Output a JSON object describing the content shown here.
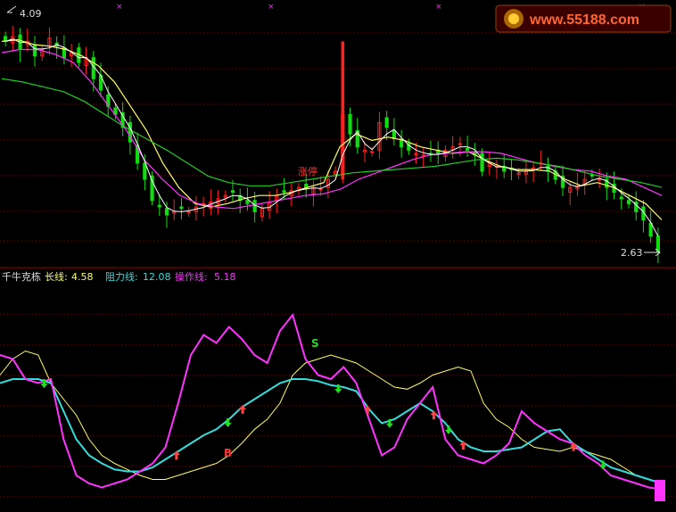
{
  "watermark": {
    "site": "www.55188.com"
  },
  "price_pane": {
    "high_label": "4.09",
    "low_label": "2.63",
    "limit_up_label": "涨停"
  },
  "indicator_pane": {
    "name": "千牛克栋",
    "lines": [
      {
        "key": "long",
        "label": "长线:",
        "value": "4.58",
        "color": "#ffff66"
      },
      {
        "key": "resistance",
        "label": "阻力线:",
        "value": "12.08",
        "color": "#33dddd"
      },
      {
        "key": "operation",
        "label": "操作线:",
        "value": "5.18",
        "color": "#ff33ff"
      }
    ],
    "signals": {
      "buy": "B",
      "sell": "S"
    }
  },
  "colors": {
    "up": "#ff2020",
    "down": "#11dd11",
    "ma5": "#ffffff",
    "ma10": "#ffff66",
    "ma20": "#ff33ff",
    "ma60": "#22cc22",
    "grid": "#7a0000",
    "divider": "#990000"
  },
  "chart_data": [
    {
      "type": "candlestick",
      "title": "",
      "ylim": [
        2.6,
        4.15
      ],
      "price_close_path": [
        3.95,
        3.98,
        3.9,
        3.95,
        3.86,
        3.9,
        3.97,
        3.92,
        3.85,
        3.88,
        3.82,
        3.85,
        3.72,
        3.65,
        3.55,
        3.5,
        3.42,
        3.33,
        3.2,
        3.1,
        2.97,
        2.93,
        2.88,
        2.9,
        2.92,
        2.9,
        2.93,
        2.95,
        2.96,
        2.98,
        3.0,
        3.02,
        2.97,
        2.95,
        2.9,
        2.92,
        2.96,
        3.0,
        3.02,
        3.03,
        3.05,
        3.04,
        3.05,
        3.04,
        3.1,
        3.15,
        3.5,
        3.38,
        3.3,
        3.28,
        3.27,
        3.45,
        3.42,
        3.35,
        3.3,
        3.28,
        3.26,
        3.25,
        3.25,
        3.26,
        3.28,
        3.3,
        3.32,
        3.28,
        3.25,
        3.15,
        3.2,
        3.18,
        3.15,
        3.16,
        3.14,
        3.15,
        3.17,
        3.2,
        3.15,
        3.1,
        3.05,
        3.05,
        3.06,
        3.1,
        3.12,
        3.1,
        3.05,
        3.02,
        2.98,
        2.95,
        2.9,
        2.85,
        2.75,
        2.65
      ],
      "limit_up_day": 46,
      "moving_averages": [
        {
          "name": "MA5",
          "values": [
            3.95,
            3.96,
            3.93,
            3.92,
            3.9,
            3.86,
            3.8,
            3.7,
            3.55,
            3.4,
            3.2,
            3.05,
            2.95,
            2.93,
            2.95,
            2.98,
            3.0,
            3.0,
            3.02,
            3.05,
            3.08,
            3.3,
            3.38,
            3.34,
            3.36,
            3.34,
            3.3,
            3.28,
            3.26,
            3.27,
            3.22,
            3.18,
            3.16,
            3.16,
            3.15,
            3.1,
            3.06,
            3.08,
            3.05,
            3.0,
            2.95,
            2.85
          ]
        },
        {
          "name": "MA20",
          "values": [
            3.88,
            3.9,
            3.9,
            3.87,
            3.82,
            3.7,
            3.55,
            3.4,
            3.22,
            3.1,
            3.0,
            2.95,
            2.93,
            2.92,
            2.94,
            2.96,
            2.98,
            3.0,
            3.01,
            3.04,
            3.1,
            3.14,
            3.18,
            3.22,
            3.25,
            3.26,
            3.27,
            3.27,
            3.26,
            3.23,
            3.2,
            3.18,
            3.16,
            3.15,
            3.12,
            3.1,
            3.05,
            3.0
          ]
        },
        {
          "name": "MA60",
          "values": [
            3.72,
            3.7,
            3.67,
            3.64,
            3.58,
            3.5,
            3.42,
            3.35,
            3.28,
            3.2,
            3.12,
            3.08,
            3.06,
            3.06,
            3.08,
            3.1,
            3.12,
            3.14,
            3.15,
            3.16,
            3.17,
            3.18,
            3.2,
            3.22,
            3.23,
            3.22,
            3.2,
            3.18,
            3.15,
            3.12,
            3.1,
            3.08,
            3.05
          ]
        }
      ]
    },
    {
      "type": "line",
      "title": "千牛克栋",
      "ylim": [
        0,
        100
      ],
      "series": [
        {
          "name": "长线",
          "values": [
            62,
            70,
            74,
            72,
            58,
            50,
            42,
            30,
            22,
            18,
            15,
            12,
            10,
            10,
            12,
            14,
            16,
            18,
            22,
            28,
            35,
            40,
            48,
            62,
            68,
            70,
            72,
            70,
            68,
            64,
            60,
            56,
            55,
            58,
            62,
            64,
            66,
            64,
            48,
            40,
            36,
            30,
            26,
            25,
            24,
            26,
            24,
            22,
            20,
            16,
            12,
            10,
            8
          ]
        },
        {
          "name": "阻力线",
          "values": [
            58,
            60,
            60,
            60,
            58,
            44,
            30,
            22,
            18,
            15,
            14,
            14,
            16,
            20,
            24,
            28,
            32,
            35,
            40,
            46,
            50,
            54,
            58,
            60,
            60,
            59,
            57,
            56,
            54,
            45,
            38,
            40,
            44,
            48,
            44,
            38,
            30,
            26,
            24,
            24,
            25,
            26,
            30,
            34,
            35,
            28,
            24,
            20,
            16,
            14,
            12,
            10,
            8
          ]
        },
        {
          "name": "操作线",
          "values": [
            72,
            70,
            60,
            58,
            60,
            30,
            12,
            8,
            6,
            8,
            10,
            14,
            18,
            26,
            48,
            72,
            82,
            78,
            86,
            80,
            72,
            68,
            84,
            92,
            70,
            62,
            60,
            66,
            58,
            40,
            22,
            26,
            40,
            48,
            56,
            30,
            22,
            20,
            18,
            22,
            28,
            44,
            38,
            34,
            30,
            28,
            22,
            18,
            12,
            10,
            8,
            6,
            5
          ]
        }
      ],
      "signals": [
        {
          "type": "sell",
          "day": 6
        },
        {
          "type": "buy",
          "day": 24
        },
        {
          "type": "sell",
          "day": 31
        },
        {
          "type": "buy",
          "day": 33
        },
        {
          "type": "sell",
          "day": 46
        },
        {
          "type": "buy",
          "day": 50
        },
        {
          "type": "sell",
          "day": 53
        },
        {
          "type": "buy",
          "day": 59
        },
        {
          "type": "sell",
          "day": 61
        },
        {
          "type": "buy",
          "day": 63
        },
        {
          "type": "buy",
          "day": 78
        },
        {
          "type": "sell",
          "day": 82
        }
      ]
    }
  ]
}
